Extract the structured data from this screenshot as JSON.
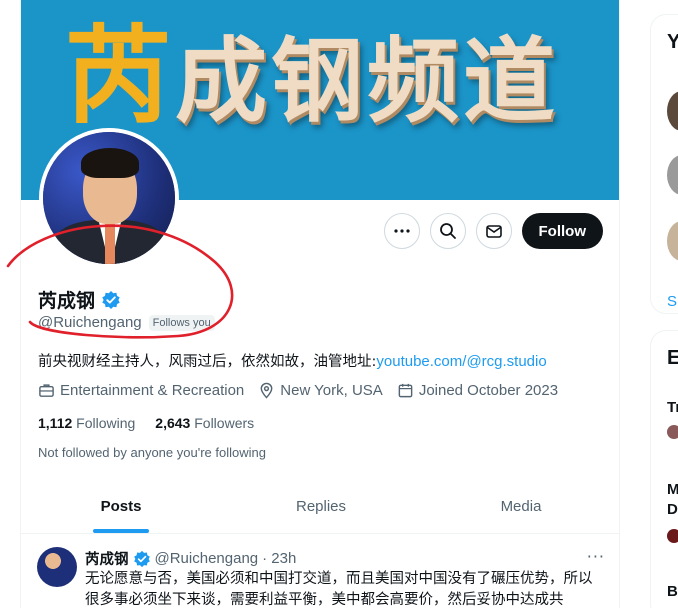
{
  "banner": {
    "title_first_char": "芮",
    "title_rest": "成钢频道"
  },
  "profile": {
    "name": "芮成钢",
    "handle": "@Ruichengang",
    "follows_you": "Follows you",
    "bio_text": "前央视财经主持人，风雨过后，依然如故，油管地址:",
    "bio_link": "youtube.com/@rcg.studio",
    "category": "Entertainment & Recreation",
    "location": "New York, USA",
    "joined": "Joined October 2023",
    "following_count": "1,112",
    "following_label": "Following",
    "followers_count": "2,643",
    "followers_label": "Followers",
    "not_followed": "Not followed by anyone you're following"
  },
  "actions": {
    "follow_label": "Follow"
  },
  "tabs": [
    {
      "label": "Posts",
      "active": true
    },
    {
      "label": "Replies",
      "active": false
    },
    {
      "label": "Media",
      "active": false
    }
  ],
  "post": {
    "name": "芮成钢",
    "handle": "@Ruichengang",
    "time": "· 23h",
    "text": "无论愿意与否，美国必须和中国打交道，而且美国对中国没有了碾压优势，所以很多事必须坐下来谈，需要利益平衡，美中都会高要价，然后妥协中达成共"
  },
  "sidebar": {
    "card1_title": "Y",
    "card1_link": "Sh",
    "card2_title": "E",
    "item1": "Tr",
    "item2": "M",
    "item2b": "D",
    "item3": "Bi"
  },
  "colors": {
    "accent": "#1d9bf0",
    "annotation": "#e0202a",
    "banner": "#1b94c8"
  }
}
